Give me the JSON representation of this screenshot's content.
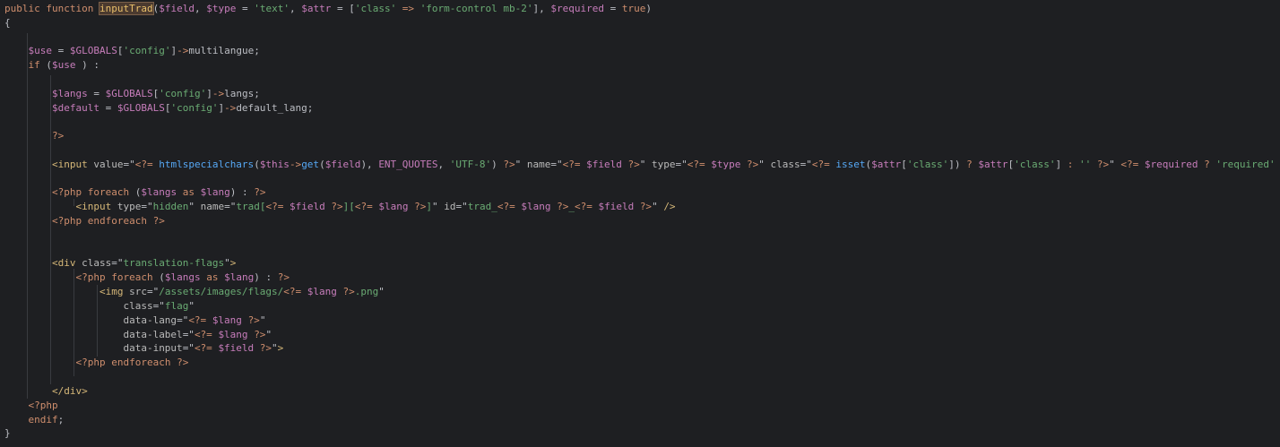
{
  "editor": {
    "lines": [
      [
        [
          "kw",
          "public "
        ],
        [
          "kw",
          "function "
        ],
        [
          "fn hl",
          "inputTrad"
        ],
        [
          "",
          "("
        ],
        [
          "var",
          "$field"
        ],
        [
          "",
          ", "
        ],
        [
          "var",
          "$type"
        ],
        [
          "",
          " = "
        ],
        [
          "str",
          "'text'"
        ],
        [
          "",
          ", "
        ],
        [
          "var",
          "$attr"
        ],
        [
          "",
          " = ["
        ],
        [
          "str",
          "'class'"
        ],
        [
          "kw",
          " => "
        ],
        [
          "str",
          "'form-control mb-2'"
        ],
        [
          "",
          "], "
        ],
        [
          "var",
          "$required"
        ],
        [
          "",
          " = "
        ],
        [
          "kw",
          "true"
        ],
        [
          "",
          ")"
        ]
      ],
      [
        [
          "brace",
          "{"
        ]
      ],
      [],
      [
        [
          "",
          "    "
        ],
        [
          "var",
          "$use"
        ],
        [
          "",
          " = "
        ],
        [
          "var",
          "$GLOBALS"
        ],
        [
          "",
          "["
        ],
        [
          "str",
          "'config'"
        ],
        [
          "",
          "]"
        ],
        [
          "kw",
          "->"
        ],
        [
          "",
          "multilangue;"
        ]
      ],
      [
        [
          "",
          "    "
        ],
        [
          "kw",
          "if "
        ],
        [
          "",
          "("
        ],
        [
          "var",
          "$use"
        ],
        [
          "",
          " ) :"
        ]
      ],
      [],
      [
        [
          "",
          "        "
        ],
        [
          "var",
          "$langs"
        ],
        [
          "",
          " = "
        ],
        [
          "var",
          "$GLOBALS"
        ],
        [
          "",
          "["
        ],
        [
          "str",
          "'config'"
        ],
        [
          "",
          "]"
        ],
        [
          "kw",
          "->"
        ],
        [
          "",
          "langs;"
        ]
      ],
      [
        [
          "",
          "        "
        ],
        [
          "var",
          "$default"
        ],
        [
          "",
          " = "
        ],
        [
          "var",
          "$GLOBALS"
        ],
        [
          "",
          "["
        ],
        [
          "str",
          "'config'"
        ],
        [
          "",
          "]"
        ],
        [
          "kw",
          "->"
        ],
        [
          "",
          "default_lang;"
        ]
      ],
      [],
      [
        [
          "",
          "        "
        ],
        [
          "php",
          "?>"
        ]
      ],
      [],
      [
        [
          "",
          "        "
        ],
        [
          "tag",
          "<input "
        ],
        [
          "attr",
          "value"
        ],
        [
          "",
          "=\""
        ],
        [
          "php",
          "<?= "
        ],
        [
          "fn",
          "htmlspecialchars"
        ],
        [
          "",
          "("
        ],
        [
          "var",
          "$this"
        ],
        [
          "kw",
          "->"
        ],
        [
          "fn",
          "get"
        ],
        [
          "",
          "("
        ],
        [
          "var",
          "$field"
        ],
        [
          "",
          "), "
        ],
        [
          "const",
          "ENT_QUOTES"
        ],
        [
          "",
          ", "
        ],
        [
          "str",
          "'UTF-8'"
        ],
        [
          "",
          ") "
        ],
        [
          "php",
          "?>"
        ],
        [
          "",
          "\" "
        ],
        [
          "attr",
          "name"
        ],
        [
          "",
          "=\""
        ],
        [
          "php",
          "<?= "
        ],
        [
          "var",
          "$field "
        ],
        [
          "php",
          "?>"
        ],
        [
          "",
          "\" "
        ],
        [
          "attr",
          "type"
        ],
        [
          "",
          "=\""
        ],
        [
          "php",
          "<?= "
        ],
        [
          "var",
          "$type "
        ],
        [
          "php",
          "?>"
        ],
        [
          "",
          "\" "
        ],
        [
          "attr",
          "class"
        ],
        [
          "",
          "=\""
        ],
        [
          "php",
          "<?= "
        ],
        [
          "fn",
          "isset"
        ],
        [
          "",
          "("
        ],
        [
          "var",
          "$attr"
        ],
        [
          "",
          "["
        ],
        [
          "str",
          "'class'"
        ],
        [
          "",
          "]) "
        ],
        [
          "kw",
          "? "
        ],
        [
          "var",
          "$attr"
        ],
        [
          "",
          "["
        ],
        [
          "str",
          "'class'"
        ],
        [
          "",
          "] "
        ],
        [
          "kw",
          ": "
        ],
        [
          "str",
          "'' "
        ],
        [
          "php",
          "?>"
        ],
        [
          "",
          "\" "
        ],
        [
          "php",
          "<?= "
        ],
        [
          "var",
          "$required "
        ],
        [
          "kw",
          "? "
        ],
        [
          "str",
          "'required' "
        ],
        [
          "kw",
          ": "
        ],
        [
          "str",
          "'' "
        ],
        [
          "php",
          "?"
        ]
      ],
      [],
      [
        [
          "",
          "        "
        ],
        [
          "php",
          "<?php "
        ],
        [
          "kw",
          "foreach "
        ],
        [
          "",
          "("
        ],
        [
          "var",
          "$langs "
        ],
        [
          "kw",
          "as "
        ],
        [
          "var",
          "$lang"
        ],
        [
          "",
          ") : "
        ],
        [
          "php",
          "?>"
        ]
      ],
      [
        [
          "",
          "            "
        ],
        [
          "tag",
          "<input "
        ],
        [
          "attr",
          "type"
        ],
        [
          "",
          "=\""
        ],
        [
          "str",
          "hidden"
        ],
        [
          "",
          "\" "
        ],
        [
          "attr",
          "name"
        ],
        [
          "",
          "=\""
        ],
        [
          "str",
          "trad["
        ],
        [
          "php",
          "<?= "
        ],
        [
          "var",
          "$field "
        ],
        [
          "php",
          "?>"
        ],
        [
          "str",
          "]["
        ],
        [
          "php",
          "<?= "
        ],
        [
          "var",
          "$lang "
        ],
        [
          "php",
          "?>"
        ],
        [
          "str",
          "]"
        ],
        [
          "",
          "\" "
        ],
        [
          "attr",
          "id"
        ],
        [
          "",
          "=\""
        ],
        [
          "str",
          "trad_"
        ],
        [
          "php",
          "<?= "
        ],
        [
          "var",
          "$lang "
        ],
        [
          "php",
          "?>"
        ],
        [
          "str",
          "_"
        ],
        [
          "php",
          "<?= "
        ],
        [
          "var",
          "$field "
        ],
        [
          "php",
          "?>"
        ],
        [
          "",
          "\" "
        ],
        [
          "tag",
          "/>"
        ]
      ],
      [
        [
          "",
          "        "
        ],
        [
          "php",
          "<?php "
        ],
        [
          "kw",
          "endforeach "
        ],
        [
          "php",
          "?>"
        ]
      ],
      [],
      [],
      [
        [
          "",
          "        "
        ],
        [
          "tag",
          "<div "
        ],
        [
          "attr",
          "class"
        ],
        [
          "",
          "=\""
        ],
        [
          "str",
          "translation-flags"
        ],
        [
          "",
          "\""
        ],
        [
          "tag",
          ">"
        ]
      ],
      [
        [
          "",
          "            "
        ],
        [
          "php",
          "<?php "
        ],
        [
          "kw",
          "foreach "
        ],
        [
          "",
          "("
        ],
        [
          "var",
          "$langs "
        ],
        [
          "kw",
          "as "
        ],
        [
          "var",
          "$lang"
        ],
        [
          "",
          ") : "
        ],
        [
          "php",
          "?>"
        ]
      ],
      [
        [
          "",
          "                "
        ],
        [
          "tag",
          "<img "
        ],
        [
          "attr",
          "src"
        ],
        [
          "",
          "=\""
        ],
        [
          "str",
          "/assets/images/flags/"
        ],
        [
          "php",
          "<?= "
        ],
        [
          "var",
          "$lang "
        ],
        [
          "php",
          "?>"
        ],
        [
          "str",
          ".png"
        ],
        [
          "",
          "\""
        ]
      ],
      [
        [
          "",
          "                    "
        ],
        [
          "attr",
          "class"
        ],
        [
          "",
          "=\""
        ],
        [
          "str",
          "flag"
        ],
        [
          "",
          "\""
        ]
      ],
      [
        [
          "",
          "                    "
        ],
        [
          "attr",
          "data-lang"
        ],
        [
          "",
          "=\""
        ],
        [
          "php",
          "<?= "
        ],
        [
          "var",
          "$lang "
        ],
        [
          "php",
          "?>"
        ],
        [
          "",
          "\""
        ]
      ],
      [
        [
          "",
          "                    "
        ],
        [
          "attr",
          "data-label"
        ],
        [
          "",
          "=\""
        ],
        [
          "php",
          "<?= "
        ],
        [
          "var",
          "$lang "
        ],
        [
          "php",
          "?>"
        ],
        [
          "",
          "\""
        ]
      ],
      [
        [
          "",
          "                    "
        ],
        [
          "attr",
          "data-input"
        ],
        [
          "",
          "=\""
        ],
        [
          "php",
          "<?= "
        ],
        [
          "var",
          "$field "
        ],
        [
          "php",
          "?>"
        ],
        [
          "",
          "\""
        ],
        [
          "tag",
          ">"
        ]
      ],
      [
        [
          "",
          "            "
        ],
        [
          "php",
          "<?php "
        ],
        [
          "kw",
          "endforeach "
        ],
        [
          "php",
          "?>"
        ]
      ],
      [],
      [
        [
          "",
          "        "
        ],
        [
          "tag",
          "</div>"
        ]
      ],
      [
        [
          "",
          "    "
        ],
        [
          "php",
          "<?php"
        ]
      ],
      [
        [
          "",
          "    "
        ],
        [
          "kw",
          "endif"
        ],
        [
          "",
          ";"
        ]
      ],
      [
        [
          "brace",
          "}"
        ]
      ]
    ]
  }
}
